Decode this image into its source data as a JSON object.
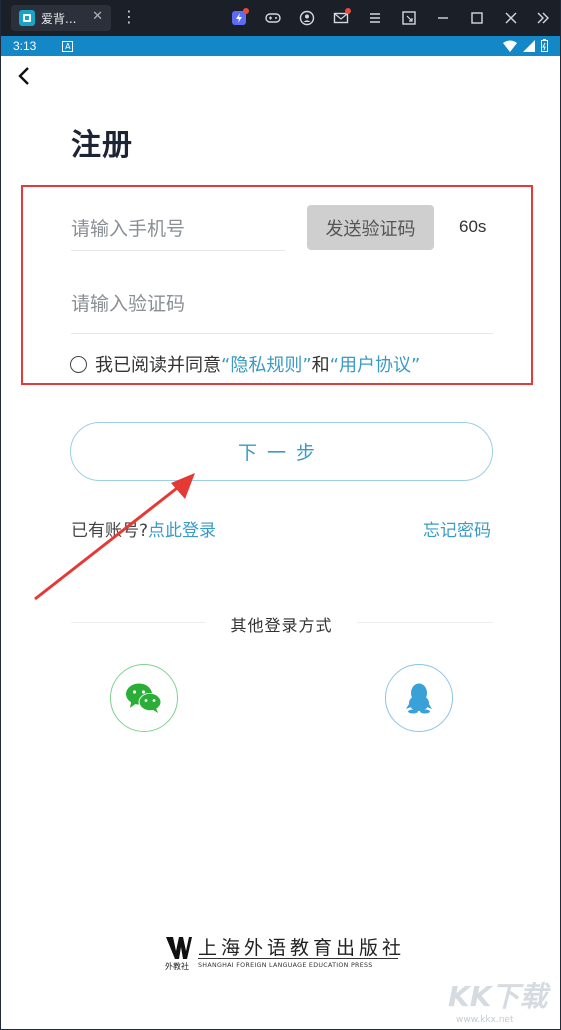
{
  "window": {
    "tab_title": "爱背...",
    "tab_close": "✕",
    "menu_glyph": "⋮"
  },
  "status_bar": {
    "time": "3:13",
    "notification_glyph": "A"
  },
  "page": {
    "title": "注册",
    "phone_placeholder": "请输入手机号",
    "send_code_label": "发送验证码",
    "countdown": "60s",
    "code_placeholder": "请输入验证码",
    "agree_prefix": "我已阅读并同意",
    "privacy_link": "“隐私规则”",
    "agree_and": "和",
    "terms_link": "“用户协议”",
    "next_label": "下一步",
    "have_account": "已有账号?",
    "login_link": "点此登录",
    "forgot_password": "忘记密码",
    "other_login": "其他登录方式"
  },
  "social": [
    {
      "name": "wechat",
      "icon": "wechat-icon",
      "color": "#2aae37"
    },
    {
      "name": "qq",
      "icon": "qq-icon",
      "color": "#3aa0d8"
    }
  ],
  "footer": {
    "publisher_cn": "上海外语教育出版社",
    "publisher_short": "外教社",
    "publisher_en": "SHANGHAI FOREIGN LANGUAGE EDUCATION PRESS"
  },
  "watermark": {
    "main": "KK下载",
    "url": "www.kkx.net"
  },
  "colors": {
    "accent": "#3a9bc4",
    "status_bar": "#1487c7",
    "highlight": "#e13b3b",
    "button_disabled": "#cfcfcf"
  }
}
